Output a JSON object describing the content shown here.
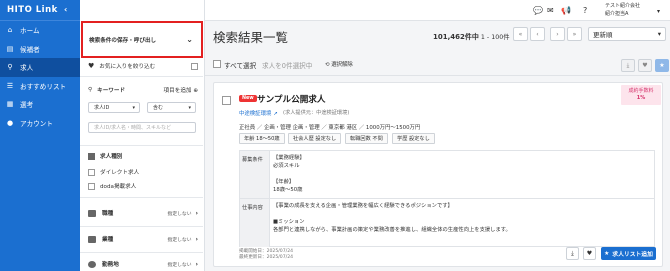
{
  "app": {
    "logo": "HITO Link"
  },
  "nav": {
    "items": [
      {
        "label": "ホーム",
        "icon": "home-icon"
      },
      {
        "label": "候補者",
        "icon": "candidate-icon"
      },
      {
        "label": "求人",
        "icon": "search-icon"
      },
      {
        "label": "おすすめリスト",
        "icon": "list-icon"
      },
      {
        "label": "選考",
        "icon": "selection-icon"
      },
      {
        "label": "アカウント",
        "icon": "account-icon"
      }
    ]
  },
  "filter": {
    "save_label": "検索条件の保存・呼び出し",
    "favorite_label": "お気に入りを絞り込む",
    "keyword_label": "キーワード",
    "add_item_label": "項目を追加",
    "keyword_field": "求人ID",
    "keyword_match": "含む",
    "keyword_placeholder": "求人ID/求人名・時間、スキルなど",
    "type_label": "求人種別",
    "type_option1": "ダイレクト求人",
    "type_option2": "doda掲載求人",
    "cat1": "職種",
    "cat2": "業種",
    "cat3": "勤務地",
    "not_specified": "指定しない"
  },
  "header": {
    "user_line1": "テスト紹介会社",
    "user_line2": "紹介担当A"
  },
  "results": {
    "title": "検索結果一覧",
    "count": "101,462件中",
    "range": "1 - 100件",
    "sort": "更新順",
    "select_all": "すべて選択",
    "selected": "求人を0件選択中",
    "clear": "選択解除"
  },
  "card": {
    "new_badge": "New",
    "name": "サンプル公開求人",
    "company": "中途検証環境",
    "employer": "(求人提供元：中途検証環境)",
    "fee_badge_line1": "成約手数料",
    "fee_badge_line2": "1%",
    "tags_line1": "正社員 ／ 企画・管理 企画・管理 ／ 東京都 港区 ／ 1000万円〜1500万円",
    "tags": [
      "年齢 18〜50歳",
      "社会人歴 設定なし",
      "転職回数 不問",
      "学歴 設定なし"
    ],
    "req_label": "募集条件",
    "req_lines": [
      "【業務経験】",
      "必須スキル",
      "",
      "【年齢】",
      "18歳〜50歳"
    ],
    "job_label": "仕事内容",
    "job_lines": [
      "【事業の成長を支える企画・管理業務を幅広く経験できるポジションです】",
      "",
      "■ミッション",
      "各部門と連携しながら、事業計画の策定や業務改善を推進し、組織全体の生産性向上を支援します。"
    ],
    "date1": "掲載開始日：2025/07/24",
    "date2": "最終更新日：2025/07/24",
    "add_button": "求人リスト追加"
  }
}
